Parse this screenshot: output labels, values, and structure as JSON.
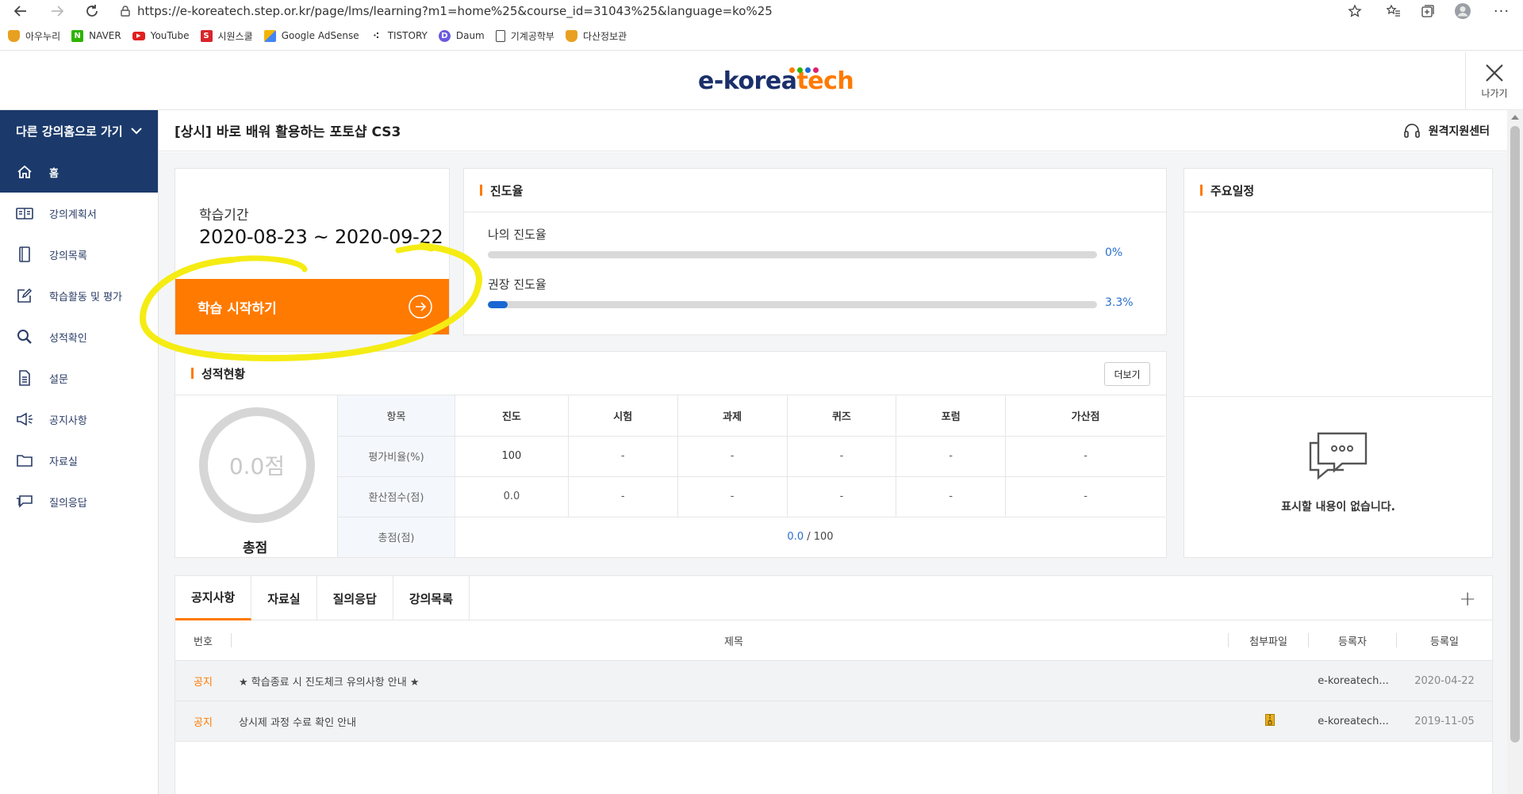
{
  "browser": {
    "url": "https://e-koreatech.step.or.kr/page/lms/learning?m1=home%25&course_id=31043%25&language=ko%25",
    "bookmarks": [
      {
        "label": "아우누리",
        "icon": "shield-icon",
        "color": "#e8a020"
      },
      {
        "label": "NAVER",
        "icon": "naver-icon",
        "color": "#2db400"
      },
      {
        "label": "YouTube",
        "icon": "youtube-icon",
        "color": "#e02020"
      },
      {
        "label": "시원스쿨",
        "icon": "siwon-icon",
        "color": "#d6262b"
      },
      {
        "label": "Google AdSense",
        "icon": "adsense-icon",
        "color": "#f4b400"
      },
      {
        "label": "TISTORY",
        "icon": "tistory-icon",
        "color": "#333333"
      },
      {
        "label": "Daum",
        "icon": "daum-icon",
        "color": "#6a5ae0"
      },
      {
        "label": "기계공학부",
        "icon": "page-icon",
        "color": "#ffffff"
      },
      {
        "label": "다산정보관",
        "icon": "shield-icon",
        "color": "#e8a020"
      }
    ]
  },
  "header": {
    "logo_part1": "e-korea",
    "logo_part2": "tech",
    "exit_label": "나가기"
  },
  "sidebar": {
    "home_link": "다른 강의홈으로 가기",
    "items": [
      {
        "label": "홈",
        "icon": "home-icon",
        "active": true
      },
      {
        "label": "강의계획서",
        "icon": "syllabus-icon"
      },
      {
        "label": "강의목록",
        "icon": "book-icon"
      },
      {
        "label": "학습활동 및 평가",
        "icon": "edit-icon"
      },
      {
        "label": "성적확인",
        "icon": "search-icon"
      },
      {
        "label": "설문",
        "icon": "document-icon"
      },
      {
        "label": "공지사항",
        "icon": "megaphone-icon"
      },
      {
        "label": "자료실",
        "icon": "folder-icon"
      },
      {
        "label": "질의응답",
        "icon": "chat-icon"
      }
    ]
  },
  "course": {
    "title": "[상시] 바로 배워 활용하는 포토샵 CS3",
    "remote_support": "원격지원센터"
  },
  "period": {
    "label": "학습기간",
    "value": "2020-08-23 ~ 2020-09-22",
    "start_button": "학습 시작하기"
  },
  "progress": {
    "title": "진도율",
    "mine_label": "나의 진도율",
    "mine_value": "0%",
    "mine_fraction": 0,
    "recommended_label": "권장 진도율",
    "recommended_value": "3.3%",
    "recommended_fraction": 0.033
  },
  "grades": {
    "title": "성적현황",
    "more_button": "더보기",
    "score_display": "0.0점",
    "total_label": "총점",
    "columns": [
      "항목",
      "진도",
      "시험",
      "과제",
      "퀴즈",
      "포럼",
      "가산점"
    ],
    "weight_row": [
      "평가비율(%)",
      "100",
      "-",
      "-",
      "-",
      "-",
      "-"
    ],
    "converted_row": [
      "환산점수(점)",
      "0.0",
      "-",
      "-",
      "-",
      "-",
      "-"
    ],
    "total_row_label": "총점(점)",
    "total_row_score": "0.0",
    "total_row_max": " / 100"
  },
  "schedule": {
    "title": "주요일정",
    "empty_text": "표시할 내용이 없습니다."
  },
  "board": {
    "tabs": [
      "공지사항",
      "자료실",
      "질의응답",
      "강의목록"
    ],
    "columns": {
      "no": "번호",
      "title": "제목",
      "file": "첨부파일",
      "author": "등록자",
      "date": "등록일"
    },
    "rows": [
      {
        "no": "공지",
        "title": "★ 학습종료 시 진도체크 유의사항 안내 ★",
        "has_file": false,
        "author": "e-koreatech...",
        "date": "2020-04-22"
      },
      {
        "no": "공지",
        "title": "상시제 과정 수료 확인 안내",
        "has_file": true,
        "author": "e-koreatech...",
        "date": "2019-11-05"
      }
    ]
  },
  "colors": {
    "accent": "#ff7a00",
    "navy": "#1b3a6b",
    "progress": "#1a67d2",
    "highlight": "#f5ec13"
  }
}
